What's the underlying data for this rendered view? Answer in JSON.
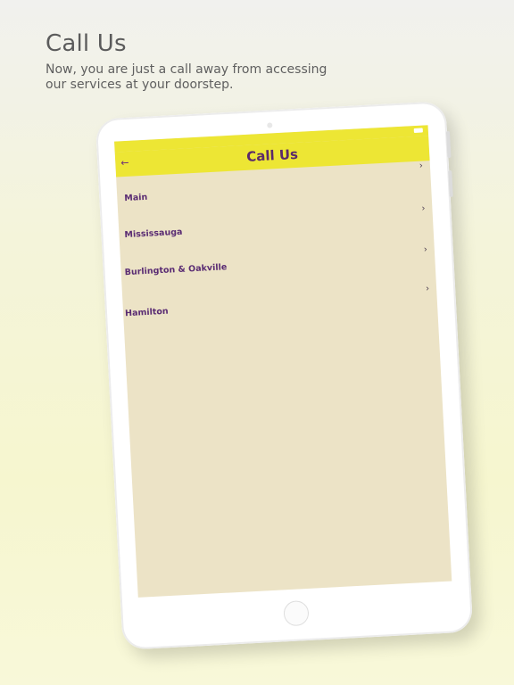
{
  "promo": {
    "headline": "Call Us",
    "subline": "Now, you are just a call away from accessing our services at your doorstep."
  },
  "app": {
    "title": "Call Us",
    "back_icon": "←",
    "chevron_icon": "›",
    "colors": {
      "app_bar": "#ede634",
      "screen_bg": "#ece3c6",
      "label": "#5a2c73",
      "title": "#5b2a6a"
    },
    "items": [
      {
        "label": "Main"
      },
      {
        "label": "Mississauga"
      },
      {
        "label": "Burlington & Oakville"
      },
      {
        "label": "Hamilton"
      }
    ]
  }
}
